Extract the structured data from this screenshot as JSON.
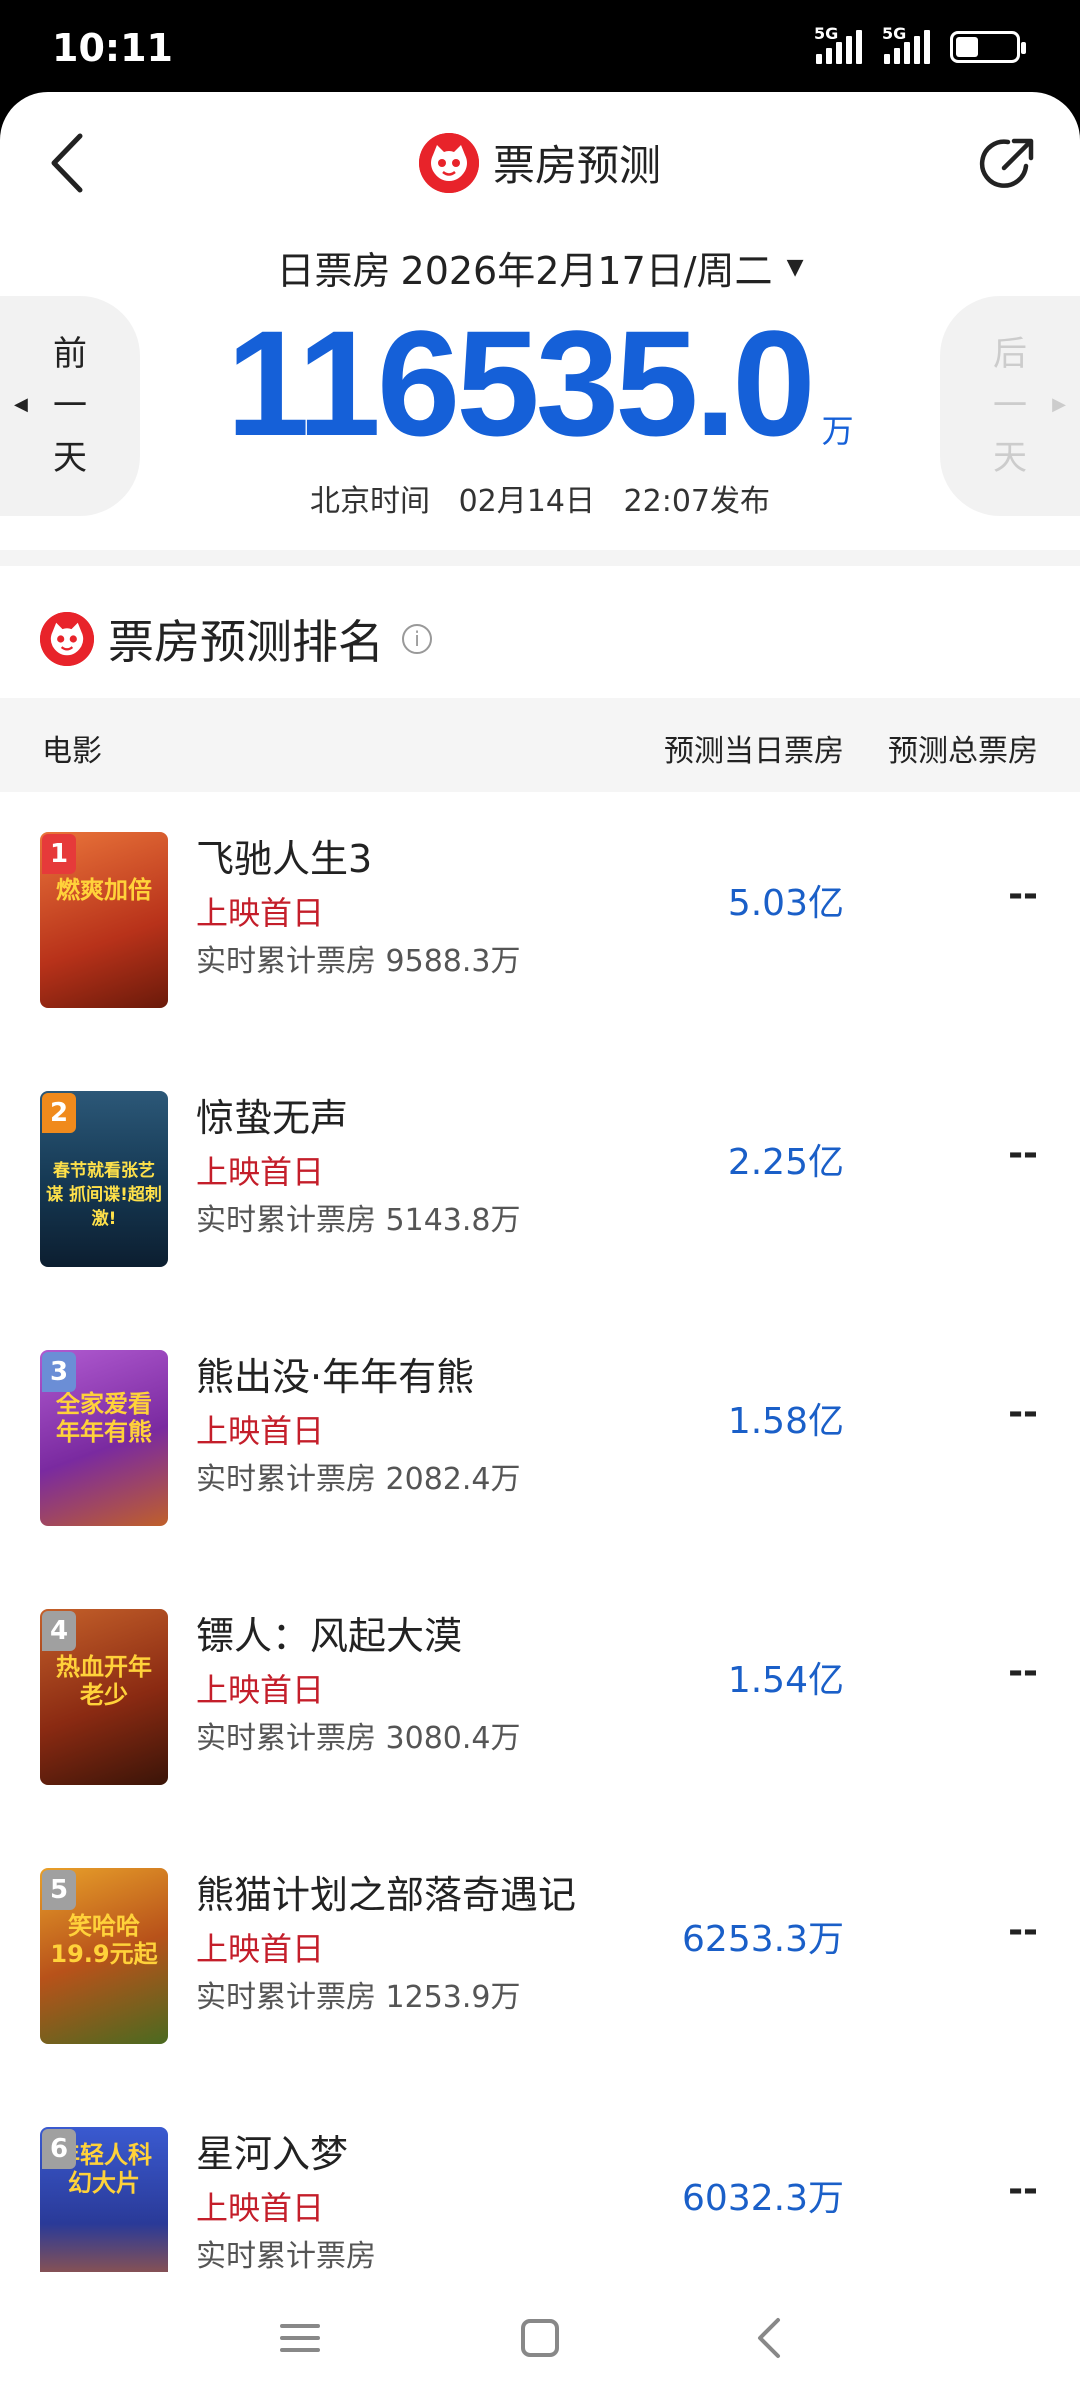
{
  "status": {
    "time": "10:11",
    "sig1": "5G",
    "sig2": "5G",
    "battery": "40"
  },
  "nav": {
    "title": "票房预测"
  },
  "date": {
    "label": "日票房",
    "value": "2026年2月17日/周二",
    "caret": "▼"
  },
  "prev_day": [
    "前",
    "一",
    "天"
  ],
  "next_day": [
    "后",
    "一",
    "天"
  ],
  "total": {
    "value": "116535.0",
    "unit": "万"
  },
  "publish": "北京时间   02月14日   22:07发布",
  "ranking": {
    "title": "票房预测排名",
    "info": "i",
    "columns": {
      "movie": "电影",
      "today": "预测当日票房",
      "total": "预测总票房"
    },
    "rows": [
      {
        "rank": "1",
        "name": "飞驰人生3",
        "tag": "上映首日",
        "cumulative": "实时累计票房 9588.3万",
        "today": "5.03亿",
        "total": "--",
        "poster_bg": "#d8502a",
        "poster_text": "燃爽加倍",
        "poster_color": "#ffd23a",
        "badge": "#e63a3a"
      },
      {
        "rank": "2",
        "name": "惊蛰无声",
        "tag": "上映首日",
        "cumulative": "实时累计票房 5143.8万",
        "today": "2.25亿",
        "total": "--",
        "poster_bg": "#1d4a6a",
        "poster_text": "春节就看张艺谋 抓间谍!超刺激!",
        "poster_color": "#ffe14a",
        "badge": "#f08a1c"
      },
      {
        "rank": "3",
        "name": "熊出没·年年有熊",
        "tag": "上映首日",
        "cumulative": "实时累计票房 2082.4万",
        "today": "1.58亿",
        "total": "--",
        "poster_bg": "#8a3fb0",
        "poster_text": "全家爱看 年年有熊",
        "poster_color": "#ffd23a",
        "badge": "#6b8ed6"
      },
      {
        "rank": "4",
        "name": "镖人：风起大漠",
        "tag": "上映首日",
        "cumulative": "实时累计票房 3080.4万",
        "today": "1.54亿",
        "total": "--",
        "poster_bg": "#9a3a1a",
        "poster_text": "热血开年 老少",
        "poster_color": "#ffd23a",
        "badge": "#999999"
      },
      {
        "rank": "5",
        "name": "熊猫计划之部落奇遇记",
        "tag": "上映首日",
        "cumulative": "实时累计票房 1253.9万",
        "today": "6253.3万",
        "total": "--",
        "poster_bg": "#3a7a2a",
        "poster_text": "笑哈哈 19.9元起",
        "poster_color": "#ffd23a",
        "badge": "#999999"
      },
      {
        "rank": "6",
        "name": "星河入梦",
        "tag": "上映首日",
        "cumulative": "实时累计票房",
        "today": "6032.3万",
        "total": "--",
        "poster_bg": "#3a4aa8",
        "poster_text": "年轻人科幻大片",
        "poster_color": "#ffd23a",
        "badge": "#999999"
      }
    ]
  }
}
